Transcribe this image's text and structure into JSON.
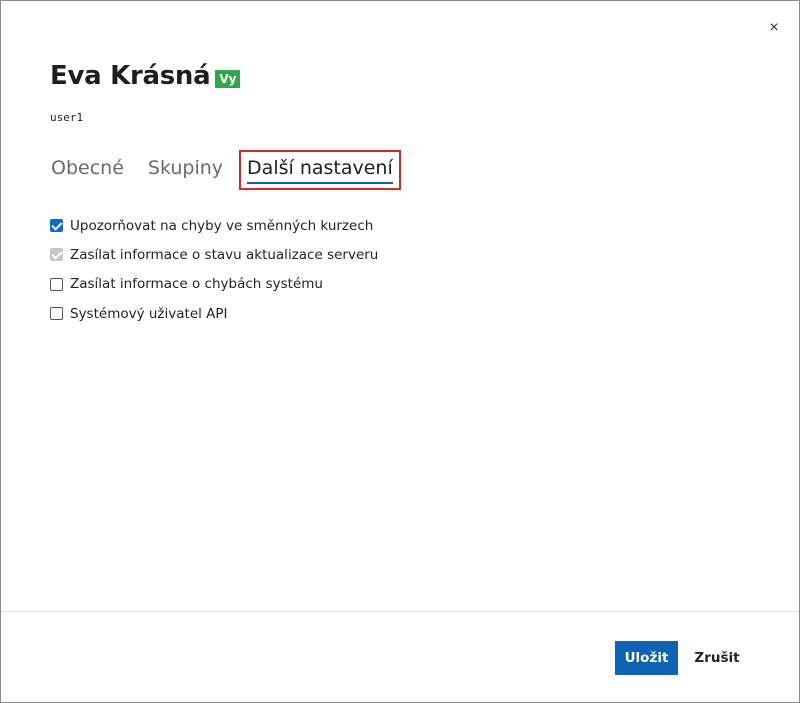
{
  "dialog": {
    "close_icon": "×",
    "title": "Eva Krásná",
    "badge": "Vy",
    "username": "user1"
  },
  "tabs": [
    {
      "label": "Obecné",
      "active": false
    },
    {
      "label": "Skupiny",
      "active": false
    },
    {
      "label": "Další nastavení",
      "active": true
    }
  ],
  "options": [
    {
      "label": "Upozorňovat na chyby ve směnných kurzech",
      "checked": true,
      "disabled": false
    },
    {
      "label": "Zasílat informace o stavu aktualizace serveru",
      "checked": true,
      "disabled": true
    },
    {
      "label": "Zasílat informace o chybách systému",
      "checked": false,
      "disabled": false
    },
    {
      "label": "Systémový uživatel API",
      "checked": false,
      "disabled": false
    }
  ],
  "footer": {
    "save_label": "Uložit",
    "cancel_label": "Zrušit"
  },
  "colors": {
    "primary": "#0e63b5",
    "badge": "#2ea84a",
    "highlight_border": "#d62828",
    "checkbox_checked": "#0b68d3"
  }
}
